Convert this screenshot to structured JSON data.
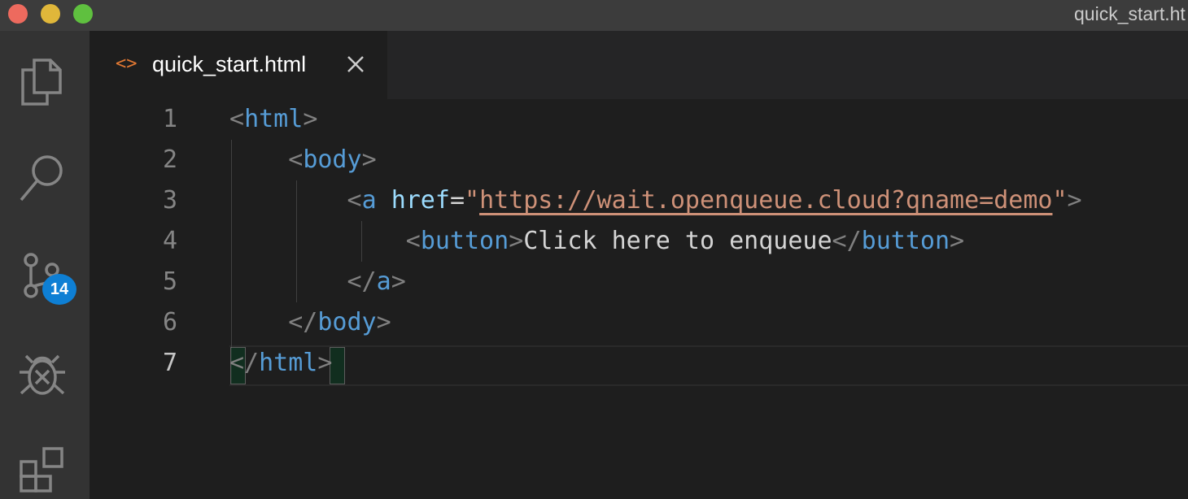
{
  "window": {
    "title": "quick_start.ht",
    "traffic_lights": [
      "close",
      "minimize",
      "maximize"
    ]
  },
  "activity_bar": {
    "items": [
      {
        "name": "explorer",
        "icon": "files-icon"
      },
      {
        "name": "search",
        "icon": "search-icon"
      },
      {
        "name": "source-control",
        "icon": "source-control-icon",
        "badge": "14"
      },
      {
        "name": "debug",
        "icon": "debug-icon"
      },
      {
        "name": "extensions",
        "icon": "extensions-icon"
      }
    ]
  },
  "tabs": [
    {
      "label": "quick_start.html",
      "icon": "html-file-icon",
      "icon_glyph": "<>",
      "close_icon": "close-icon"
    }
  ],
  "editor": {
    "active_line": "7",
    "lines": [
      {
        "number": "1",
        "tokens": [
          {
            "t": "<",
            "c": "punct"
          },
          {
            "t": "html",
            "c": "tag"
          },
          {
            "t": ">",
            "c": "punct"
          }
        ]
      },
      {
        "number": "2",
        "tokens": [
          {
            "t": "    ",
            "c": "txt"
          },
          {
            "t": "<",
            "c": "punct"
          },
          {
            "t": "body",
            "c": "tag"
          },
          {
            "t": ">",
            "c": "punct"
          }
        ]
      },
      {
        "number": "3",
        "tokens": [
          {
            "t": "        ",
            "c": "txt"
          },
          {
            "t": "<",
            "c": "punct"
          },
          {
            "t": "a",
            "c": "tag"
          },
          {
            "t": " ",
            "c": "txt"
          },
          {
            "t": "href",
            "c": "attr"
          },
          {
            "t": "=",
            "c": "eq"
          },
          {
            "t": "\"",
            "c": "str"
          },
          {
            "t": "https://wait.openqueue.cloud?qname=demo",
            "c": "str url"
          },
          {
            "t": "\"",
            "c": "str"
          },
          {
            "t": ">",
            "c": "punct"
          }
        ]
      },
      {
        "number": "4",
        "tokens": [
          {
            "t": "            ",
            "c": "txt"
          },
          {
            "t": "<",
            "c": "punct"
          },
          {
            "t": "button",
            "c": "tag"
          },
          {
            "t": ">",
            "c": "punct"
          },
          {
            "t": "Click here to enqueue",
            "c": "txt"
          },
          {
            "t": "</",
            "c": "punct"
          },
          {
            "t": "button",
            "c": "tag"
          },
          {
            "t": ">",
            "c": "punct"
          }
        ]
      },
      {
        "number": "5",
        "tokens": [
          {
            "t": "        ",
            "c": "txt"
          },
          {
            "t": "</",
            "c": "punct"
          },
          {
            "t": "a",
            "c": "tag"
          },
          {
            "t": ">",
            "c": "punct"
          }
        ]
      },
      {
        "number": "6",
        "tokens": [
          {
            "t": "    ",
            "c": "txt"
          },
          {
            "t": "</",
            "c": "punct"
          },
          {
            "t": "body",
            "c": "tag"
          },
          {
            "t": ">",
            "c": "punct"
          }
        ]
      },
      {
        "number": "7",
        "tokens": [
          {
            "t": "</",
            "c": "punct"
          },
          {
            "t": "html",
            "c": "tag"
          },
          {
            "t": ">",
            "c": "punct"
          }
        ]
      }
    ]
  },
  "colors": {
    "background": "#1e1e1e",
    "activity_bar": "#333333",
    "title_bar": "#3c3c3c",
    "tag": "#569cd6",
    "attribute": "#9cdcfe",
    "string": "#ce9178",
    "badge": "#0e7fd4"
  }
}
